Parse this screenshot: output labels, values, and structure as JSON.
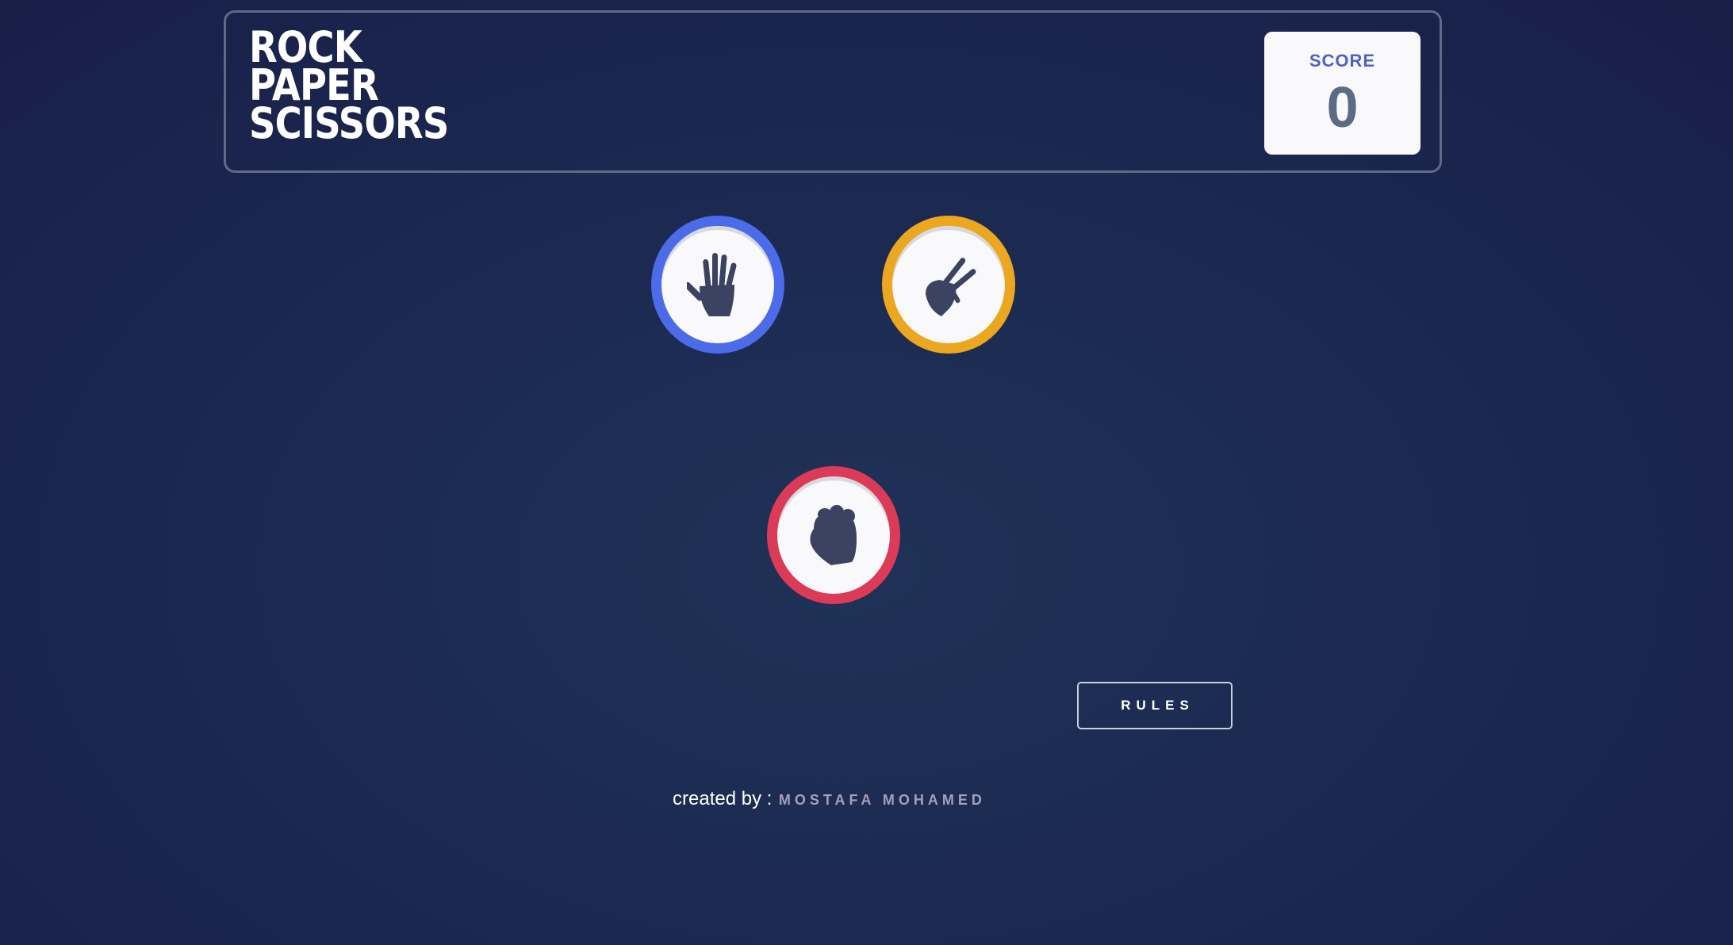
{
  "header": {
    "title_lines": [
      "ROCK",
      "PAPER",
      "SCISSORS"
    ],
    "score_label": "SCORE",
    "score_value": "0"
  },
  "choices": [
    {
      "id": "paper",
      "icon": "paper-hand-icon",
      "ring_color": "#4b6be9"
    },
    {
      "id": "scissors",
      "icon": "scissors-hand-icon",
      "ring_color": "#eba71f"
    },
    {
      "id": "rock",
      "icon": "rock-fist-icon",
      "ring_color": "#dc3b58"
    }
  ],
  "rules_button": {
    "label": "RULES"
  },
  "footer": {
    "prefix": "created by :",
    "author": "MOSTAFA MOHAMED"
  },
  "colors": {
    "background": "#1c2a52",
    "title": "#ffffff",
    "score_label": "#4a62c7",
    "score_value": "#5b6b86",
    "icon": "#3b4262"
  }
}
